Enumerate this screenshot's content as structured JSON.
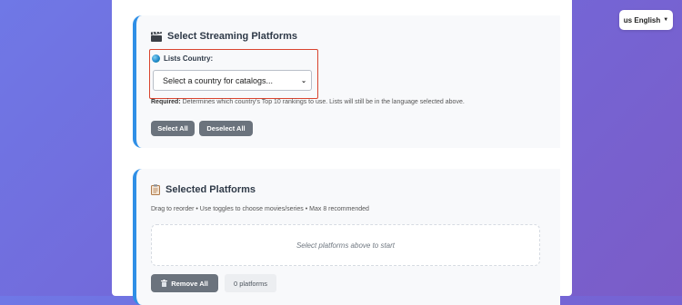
{
  "header": {
    "language_label": "us English"
  },
  "platforms_section": {
    "title": "Select Streaming Platforms",
    "country_label": "Lists Country:",
    "country_select_value": "Select a country for catalogs...",
    "required_label": "Required:",
    "required_text": "Determines which country's Top 10 rankings to use. Lists will still be in the language selected above.",
    "select_all_label": "Select All",
    "deselect_all_label": "Deselect All"
  },
  "selected_section": {
    "title": "Selected Platforms",
    "instructions": "Drag to reorder • Use toggles to choose movies/series • Max 8 recommended",
    "empty_message": "Select platforms above to start",
    "remove_all_label": "Remove All",
    "count_label": "0 platforms"
  },
  "colors": {
    "accent": "#2f8fe6",
    "highlight_border": "#d9442f",
    "button_bg": "#6b737d"
  },
  "icons": [
    "clapperboard-icon",
    "globe-icon",
    "clipboard-icon",
    "trash-icon",
    "chevron-down-icon"
  ]
}
